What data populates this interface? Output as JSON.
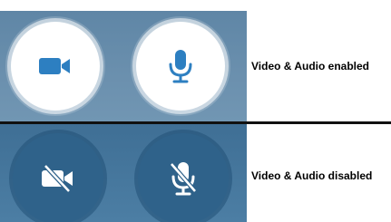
{
  "rows": [
    {
      "state": "enabled",
      "label": "Video & Audio enabled",
      "video_icon": "video-camera-icon",
      "audio_icon": "microphone-icon"
    },
    {
      "state": "disabled",
      "label": "Video & Audio disabled",
      "video_icon": "video-camera-off-icon",
      "audio_icon": "microphone-off-icon"
    }
  ],
  "colors": {
    "enabled_panel": "#6b90ae",
    "disabled_panel": "#4c7ea4",
    "enabled_button_bg": "#ffffff",
    "enabled_icon": "#2d7fc1",
    "disabled_button_bg": "#2f628a",
    "disabled_icon": "#ffffff",
    "divider": "#111111"
  }
}
